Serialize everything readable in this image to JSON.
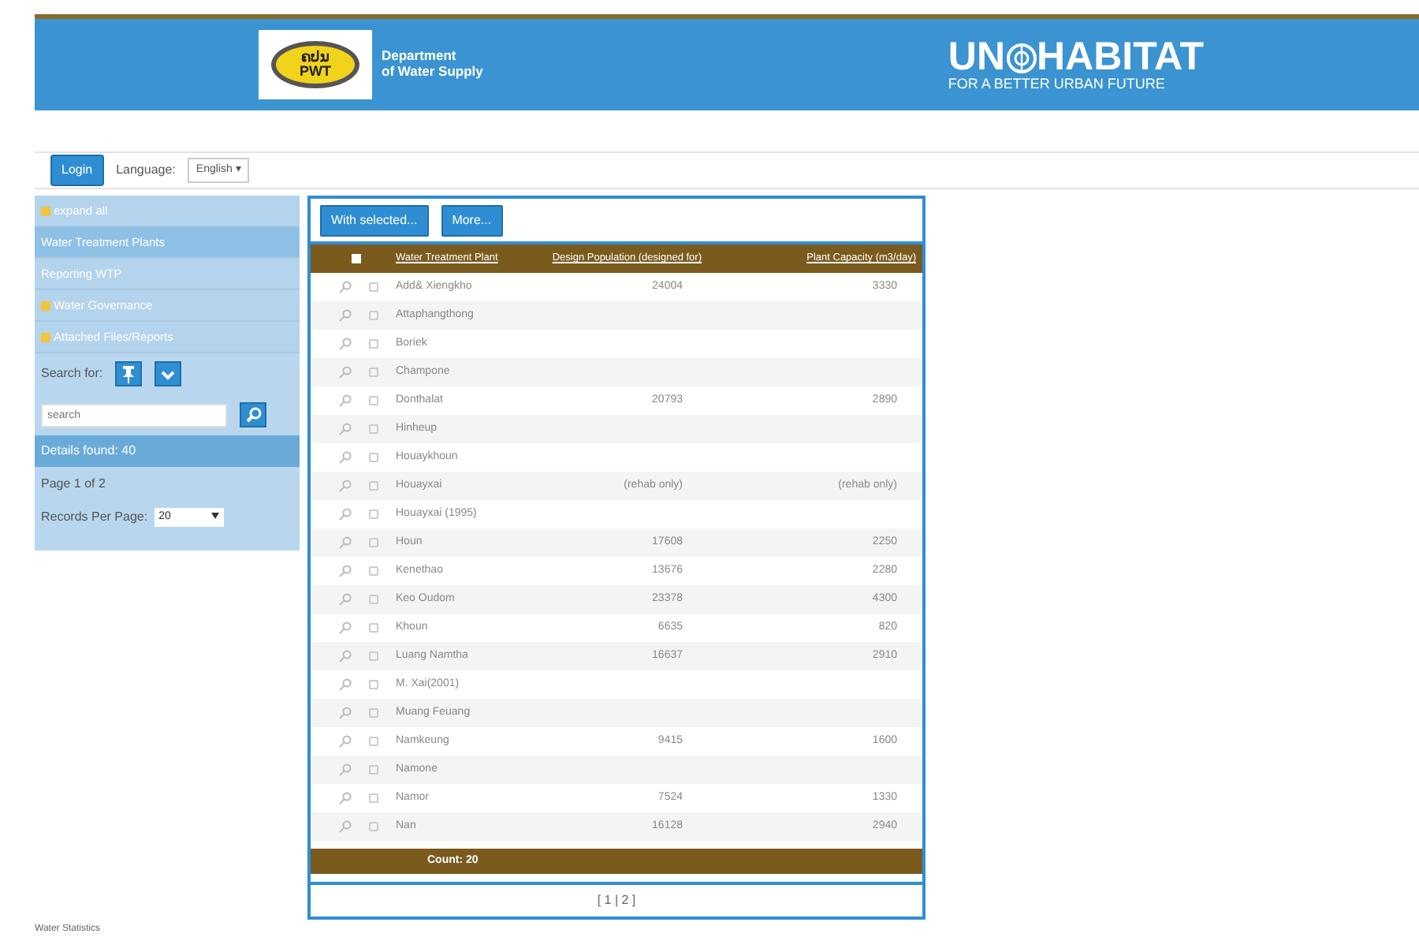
{
  "header": {
    "agency_logo": {
      "line1": "ຄປນ",
      "line2": "PWT"
    },
    "agency_name": [
      "Department",
      "of Water Supply"
    ],
    "partner": {
      "name": "UN",
      "name_end": "HABITAT",
      "tagline": "FOR A BETTER URBAN FUTURE"
    }
  },
  "toolbar": {
    "login": "Login",
    "language_label": "Language:",
    "language": "English ▾"
  },
  "sidebar": {
    "items": [
      {
        "label": "expand all",
        "kind": "expander",
        "selected": false
      },
      {
        "label": "Water Treatment Plants",
        "kind": "link",
        "selected": true
      },
      {
        "label": "Reporting WTP",
        "kind": "link",
        "selected": false
      },
      {
        "label": "Water Governance",
        "kind": "expander",
        "selected": false
      },
      {
        "label": "Attached Files/Reports",
        "kind": "expander",
        "selected": false
      }
    ],
    "search_label": "Search for:",
    "search_placeholder": "search",
    "details_found": "Details found: 40",
    "page_info": "Page 1 of 2",
    "records_label": "Records Per Page:",
    "records_value": "20"
  },
  "actions": [
    "With selected...",
    "More..."
  ],
  "table": {
    "select_all_checked": false,
    "columns": [
      "Water Treatment Plant",
      "Design Population (designed for)",
      "Plant Capacity (m3/day)"
    ],
    "rows": [
      {
        "name": "Add& Xiengkho",
        "population": "24004",
        "capacity": "3330",
        "checked": false
      },
      {
        "name": "Attaphangthong",
        "population": "",
        "capacity": "",
        "checked": false
      },
      {
        "name": "Boriek",
        "population": "",
        "capacity": "",
        "checked": false
      },
      {
        "name": "Champone",
        "population": "",
        "capacity": "",
        "checked": false
      },
      {
        "name": "Donthalat",
        "population": "20793",
        "capacity": "2890",
        "checked": false
      },
      {
        "name": "Hinheup",
        "population": "",
        "capacity": "",
        "checked": false
      },
      {
        "name": "Houaykhoun",
        "population": "",
        "capacity": "",
        "checked": false
      },
      {
        "name": "Houayxai",
        "population": "(rehab only)",
        "capacity": "(rehab only)",
        "checked": false
      },
      {
        "name": "Houayxai (1995)",
        "population": "",
        "capacity": "",
        "checked": false
      },
      {
        "name": "Houn",
        "population": "17608",
        "capacity": "2250",
        "checked": false
      },
      {
        "name": "Kenethao",
        "population": "13676",
        "capacity": "2280",
        "checked": false
      },
      {
        "name": "Keo Oudom",
        "population": "23378",
        "capacity": "4300",
        "checked": false
      },
      {
        "name": "Khoun",
        "population": "6635",
        "capacity": "820",
        "checked": false
      },
      {
        "name": "Luang Namtha",
        "population": "16637",
        "capacity": "2910",
        "checked": false
      },
      {
        "name": "M. Xai(2001)",
        "population": "",
        "capacity": "",
        "checked": false
      },
      {
        "name": "Muang Feuang",
        "population": "",
        "capacity": "",
        "checked": false
      },
      {
        "name": "Namkeung",
        "population": "9415",
        "capacity": "1600",
        "checked": false
      },
      {
        "name": "Namone",
        "population": "",
        "capacity": "",
        "checked": false
      },
      {
        "name": "Namor",
        "population": "7524",
        "capacity": "1330",
        "checked": false
      },
      {
        "name": "Nan",
        "population": "16128",
        "capacity": "2940",
        "checked": false
      }
    ],
    "count": "Count: 20"
  },
  "pager": "[ 1 | 2 ]",
  "footer": "Water Statistics"
}
